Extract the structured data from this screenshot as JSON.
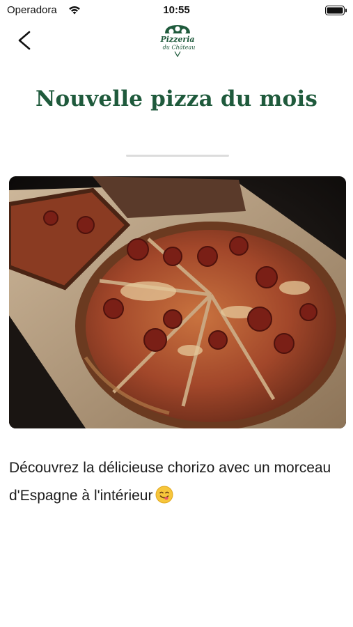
{
  "status_bar": {
    "carrier": "Operadora",
    "time": "10:55",
    "wifi_icon": "wifi-icon",
    "battery_icon": "battery-icon"
  },
  "nav": {
    "back_icon": "chevron-left-icon",
    "logo": {
      "line1": "Pizzeria",
      "line2": "du Château",
      "brand_color": "#1f5a3c"
    }
  },
  "content": {
    "title": "Nouvelle pizza du mois",
    "image": "pepperoni-pizza-photo",
    "description": "Découvrez la délicieuse chorizo avec un morceau d'Espagne à l'intérieur",
    "emoji_icon": "smiling-face-savoring-food-emoji"
  },
  "colors": {
    "title": "#1f5a3c",
    "divider": "#dcdcdc",
    "text": "#1c1c1c"
  }
}
